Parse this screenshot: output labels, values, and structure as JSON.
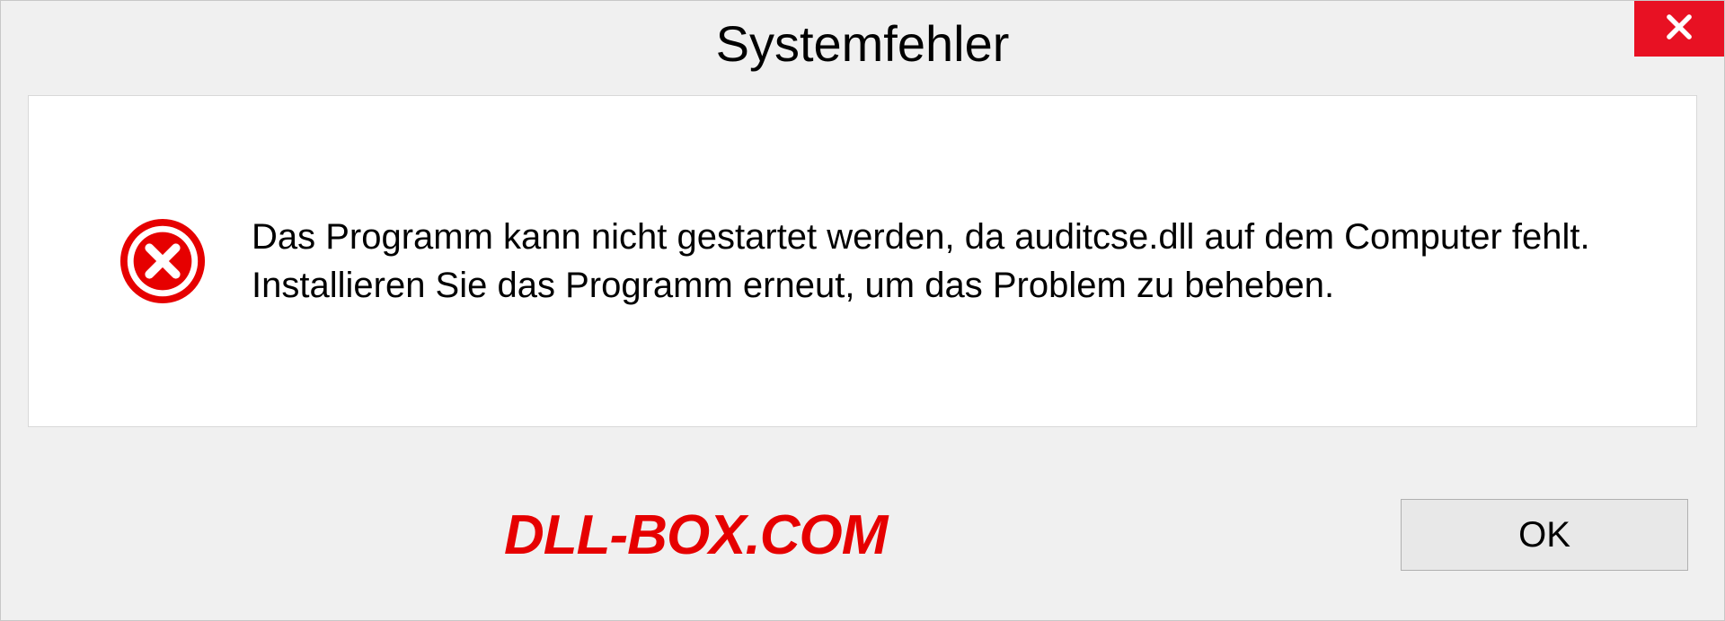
{
  "dialog": {
    "title": "Systemfehler",
    "message": "Das Programm kann nicht gestartet werden, da auditcse.dll auf dem Computer fehlt. Installieren Sie das Programm erneut, um das Problem zu beheben.",
    "ok_label": "OK"
  },
  "watermark": "DLL-BOX.COM",
  "colors": {
    "close_bg": "#e81123",
    "error_icon": "#e60000",
    "watermark": "#e60000"
  }
}
